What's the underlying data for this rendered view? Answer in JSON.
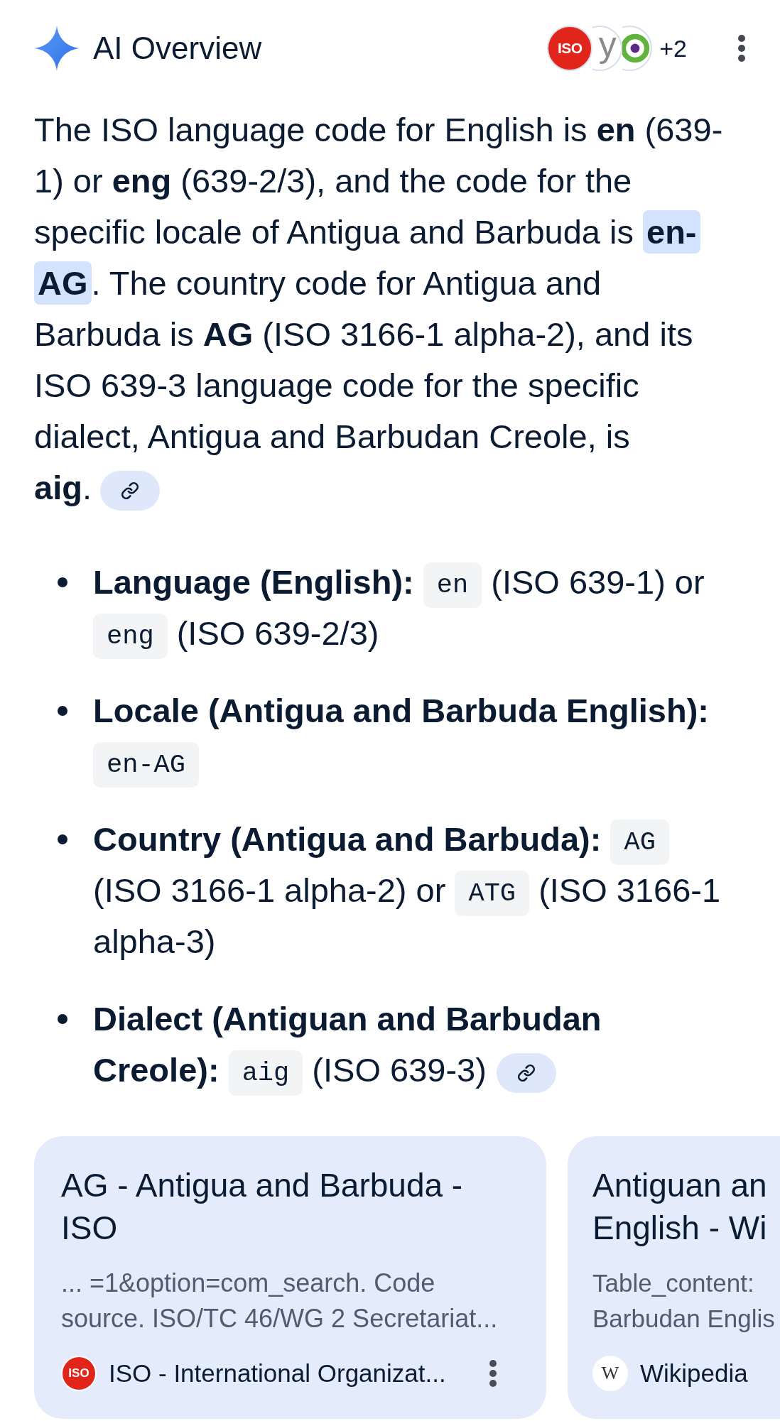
{
  "header": {
    "title": "AI Overview",
    "sources": [
      {
        "kind": "badge",
        "text": "ISO"
      },
      {
        "kind": "letter",
        "text": "y"
      },
      {
        "kind": "ring"
      }
    ],
    "more_sources": "+2"
  },
  "summary": {
    "runs": [
      {
        "text": "The ISO language code for English is **en** (639-1) or **eng** (639-2/3), and the code for the specific locale of Antigua and Barbuda is ",
        "highlighted": false
      },
      {
        "text": "**en-AG**",
        "highlighted": true
      },
      {
        "text": ". The country code for Antigua and Barbuda is **AG** (ISO 3166-1 alpha-2), and its ISO 639-3 language code for the specific dialect, Antigua and Barbudan Creole, is **aig**.",
        "highlighted": false
      }
    ],
    "link": true
  },
  "bullets": [
    {
      "label": "Language (English):",
      "parts": [
        {
          "kind": "code",
          "text": "en"
        },
        {
          "kind": "text",
          "text": "(ISO 639-1) or"
        },
        {
          "kind": "code",
          "text": "eng"
        },
        {
          "kind": "text",
          "text": "(ISO 639-2/3)"
        }
      ],
      "link": false
    },
    {
      "label": "Locale (Antigua and Barbuda English):",
      "parts": [
        {
          "kind": "code",
          "text": "en-AG"
        }
      ],
      "link": false
    },
    {
      "label": "Country (Antigua and Barbuda):",
      "parts": [
        {
          "kind": "code",
          "text": "AG"
        },
        {
          "kind": "text",
          "text": "(ISO 3166-1 alpha-2) or"
        },
        {
          "kind": "code",
          "text": "ATG"
        },
        {
          "kind": "text",
          "text": "(ISO 3166-1 alpha-3)"
        }
      ],
      "link": false
    },
    {
      "label": "Dialect (Antiguan and Barbudan Creole):",
      "parts": [
        {
          "kind": "code",
          "text": "aig"
        },
        {
          "kind": "text",
          "text": "(ISO 639-3)"
        }
      ],
      "link": true
    }
  ],
  "cards": [
    {
      "title": "AG - Antigua and Barbuda - ISO",
      "snippet": "... =1&option=com_search. Code source. ISO/TC 46/WG 2 Secretariat...",
      "favicon": {
        "kind": "badge",
        "text": "ISO"
      },
      "source": "ISO - International Organizat...",
      "menu": true
    },
    {
      "title": "Antiguan an English - Wi",
      "snippet": "Table_content: Barbudan Englis",
      "favicon": {
        "kind": "serif",
        "text": "W"
      },
      "source": "Wikipedia",
      "menu": false
    }
  ]
}
